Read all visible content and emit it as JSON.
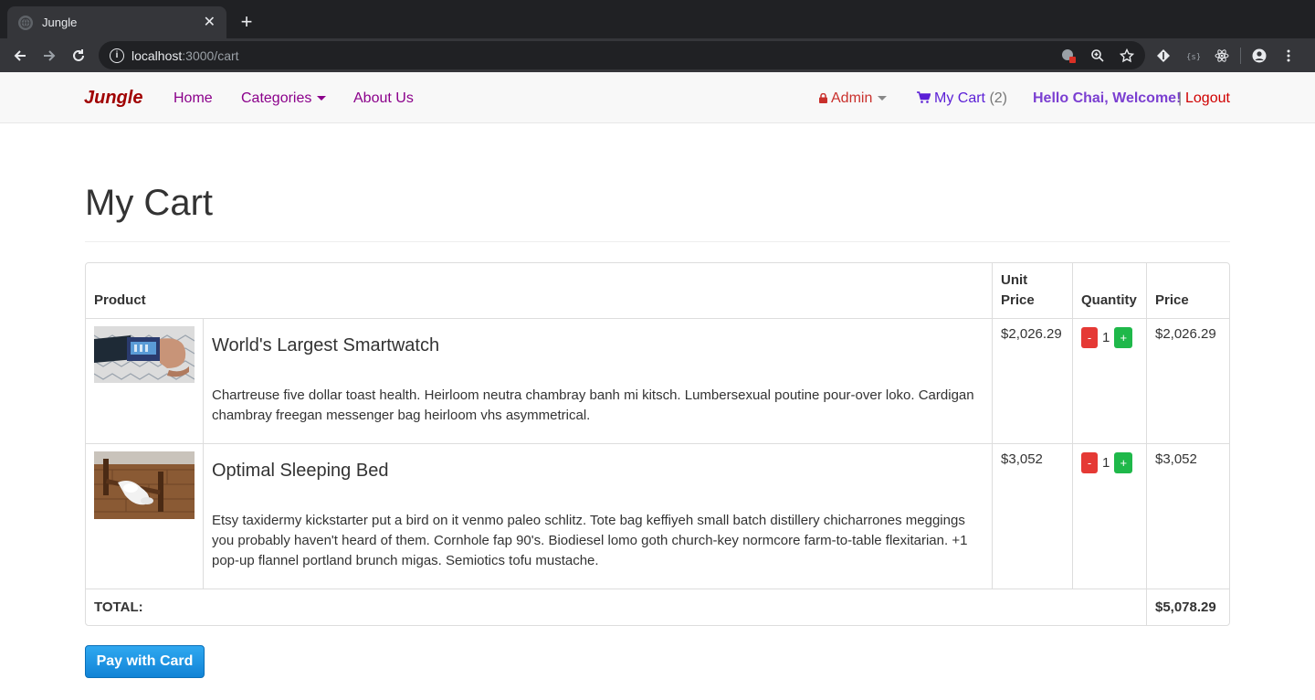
{
  "browser": {
    "tab_title": "Jungle",
    "tab_close": "✕",
    "new_tab": "+",
    "url_host": "localhost",
    "url_path": ":3000/cart"
  },
  "nav": {
    "brand": "Jungle",
    "home": "Home",
    "categories": "Categories",
    "about": "About Us",
    "admin": "Admin",
    "my_cart": "My Cart",
    "cart_count": "(2)",
    "greeting": "Hello Chai, Welcome!",
    "separator": "|",
    "logout": "Logout"
  },
  "page": {
    "title": "My Cart"
  },
  "table": {
    "headers": {
      "product": "Product",
      "unit_price_1": "Unit",
      "unit_price_2": "Price",
      "quantity": "Quantity",
      "price": "Price"
    },
    "rows": [
      {
        "name": "World's Largest Smartwatch",
        "description": "Chartreuse five dollar toast health. Heirloom neutra chambray banh mi kitsch. Lumbersexual poutine pour-over loko. Cardigan chambray freegan messenger bag heirloom vhs asymmetrical.",
        "unit_price": "$2,026.29",
        "minus": "-",
        "quantity": "1",
        "plus": "+",
        "price": "$2,026.29"
      },
      {
        "name": "Optimal Sleeping Bed",
        "description": "Etsy taxidermy kickstarter put a bird on it venmo paleo schlitz. Tote bag keffiyeh small batch distillery chicharrones meggings you probably haven't heard of them. Cornhole fap 90's. Biodiesel lomo goth church-key normcore farm-to-table flexitarian. +1 pop-up flannel portland brunch migas. Semiotics tofu mustache.",
        "unit_price": "$3,052",
        "minus": "-",
        "quantity": "1",
        "plus": "+",
        "price": "$3,052"
      }
    ],
    "total_label": "TOTAL:",
    "total_value": "$5,078.29"
  },
  "pay_button": "Pay with Card",
  "colors": {
    "brand": "#a00000",
    "nav_link": "#8b008b",
    "admin": "#c9302c",
    "cart": "#5b1fd6",
    "greeting": "#7b3fd1",
    "logout": "#d00000",
    "minus": "#e53935",
    "plus": "#1fb84a",
    "pay": "#1a8fe0"
  }
}
